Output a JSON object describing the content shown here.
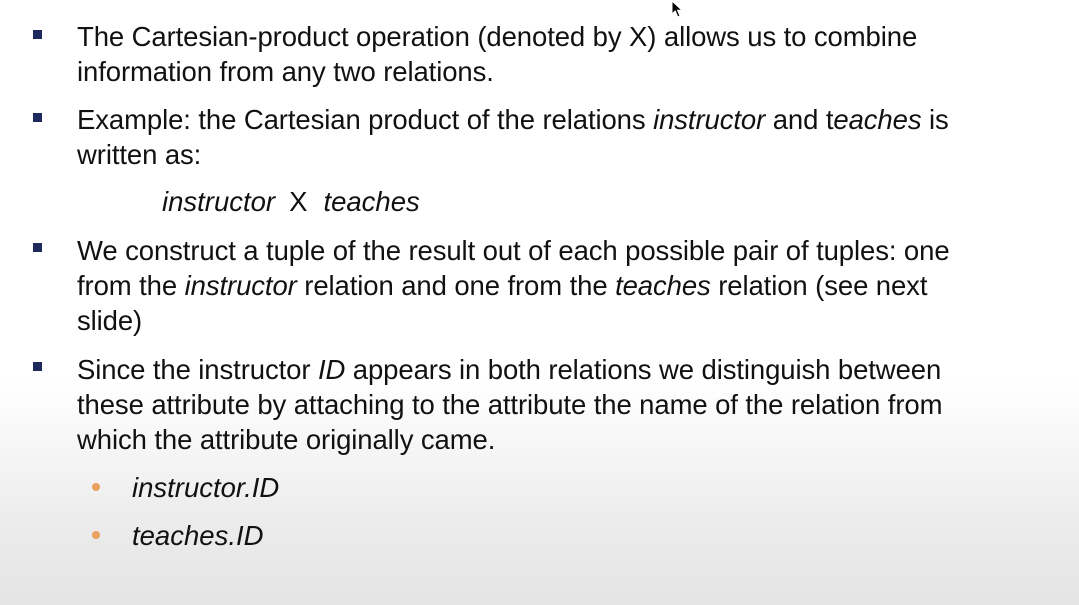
{
  "bullets": [
    {
      "lines": [
        "The Cartesian-product operation (denoted by X)  allows us to combine",
        "information from any two relations."
      ]
    },
    {
      "line1_a": "Example: the Cartesian product of the relations ",
      "line1_b": "instructor",
      "line1_c": " and t",
      "line1_d": "eaches",
      "line1_e": " is",
      "line2": "written  as:"
    },
    {
      "line1": "We construct a tuple of the result out of each possible pair of tuples: one",
      "line2_a": "from the ",
      "line2_b": "instructor",
      "line2_c": " relation and one from the ",
      "line2_d": "teaches",
      "line2_e": " relation (see next",
      "line3": "slide)"
    },
    {
      "line1_a": "Since the instructor ",
      "line1_b": "ID",
      "line1_c": " appears in both relations we distinguish between",
      "line2": "these attribute by attaching to the attribute the name of the relation from",
      "line3": "which the attribute originally came."
    }
  ],
  "formula": {
    "left": "instructor",
    "op": "X",
    "right": "teaches"
  },
  "subbullets": [
    "instructor.ID",
    "teaches.ID"
  ],
  "colors": {
    "square_bullet": "#1f2a5c",
    "sub_bullet": "#e8a05c"
  },
  "icons": {
    "cursor": "mouse-pointer-icon"
  }
}
